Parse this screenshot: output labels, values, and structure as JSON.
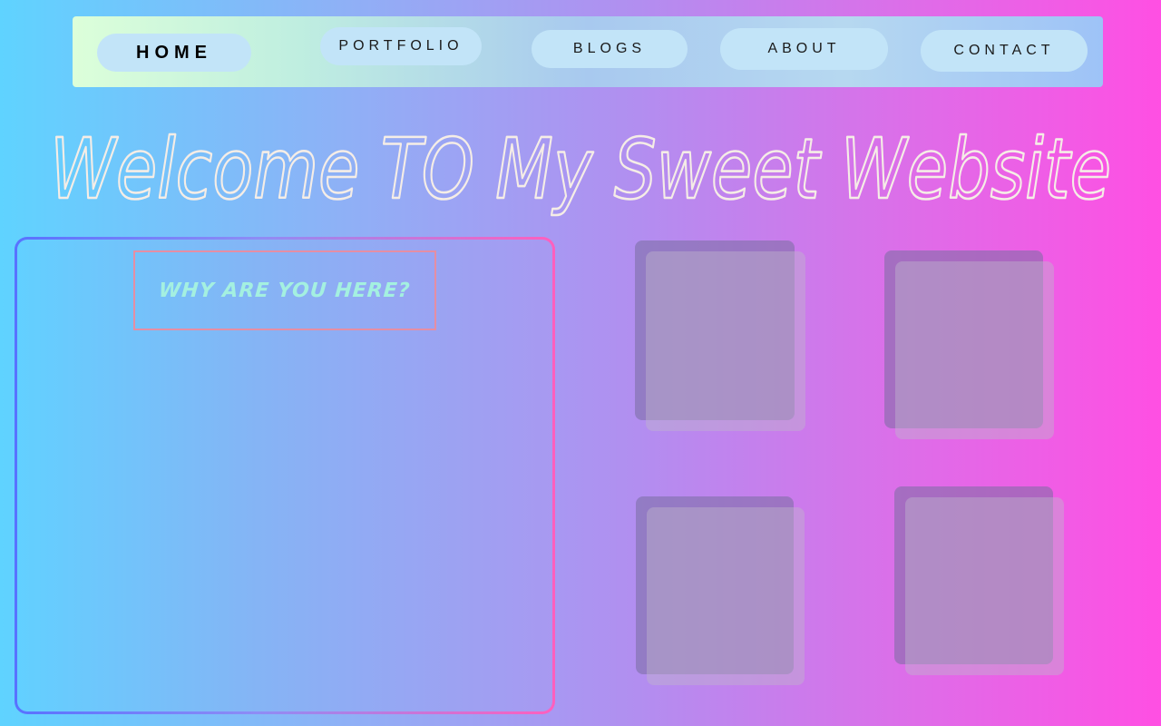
{
  "nav": {
    "items": [
      {
        "label": "HOME",
        "active": true
      },
      {
        "label": "PORTFOLIO",
        "active": false
      },
      {
        "label": "BLOGS",
        "active": false
      },
      {
        "label": "ABOUT",
        "active": false
      },
      {
        "label": "CONTACT",
        "active": false
      }
    ]
  },
  "hero": {
    "title": "Welcome TO My Sweet Website"
  },
  "panel": {
    "heading": "Why are you here?"
  },
  "gallery": {
    "count": 4
  },
  "colors": {
    "bg_left": "#5fd3ff",
    "bg_right": "#ff4fe3",
    "nav_pill": "#c2e4f8",
    "title_stroke": "#f5ede6",
    "heading_text": "#a4f0e0",
    "heading_border": "#e58ea4"
  }
}
